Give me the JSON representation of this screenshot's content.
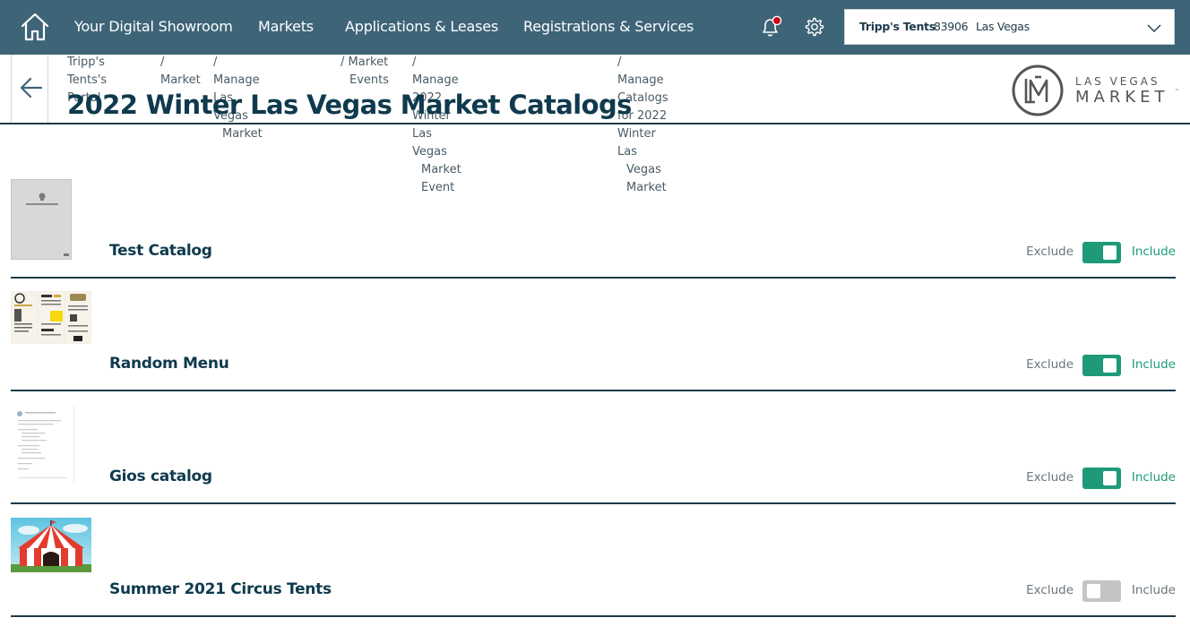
{
  "nav": {
    "items": [
      {
        "label": "Your Digital Showroom"
      },
      {
        "label": "Markets"
      },
      {
        "label": "Applications & Leases"
      },
      {
        "label": "Registrations & Services"
      }
    ],
    "account": {
      "name": "Tripp's Tents",
      "id": "83906",
      "location": "Las Vegas"
    },
    "icons": {
      "home": "home-icon",
      "bell": "bell-icon",
      "gear": "gear-icon",
      "chevron": "chevron-down-icon"
    },
    "notification_dot_color": "#d0021b"
  },
  "breadcrumb": [
    {
      "line1": "Tripp's Tents's",
      "line2": "Portal"
    },
    {
      "line1": "/ Market",
      "line2": ""
    },
    {
      "line1": "/ Manage Las Vegas",
      "line2": "Market"
    },
    {
      "line1": "/ Market",
      "line2": "Events"
    },
    {
      "line1": "/ Manage 2022 Winter Las Vegas",
      "line2": "Market Event"
    },
    {
      "line1": "/ Manage Catalogs for 2022 Winter Las",
      "line2": "Vegas Market"
    }
  ],
  "page": {
    "title": "2022 Winter Las Vegas Market Catalogs"
  },
  "logo": {
    "line1": "LAS VEGAS",
    "line2": "MARKET",
    "tm": "™"
  },
  "toggle_labels": {
    "exclude": "Exclude",
    "include": "Include"
  },
  "catalogs": [
    {
      "name": "Test Catalog",
      "included": true,
      "thumb": "gray-cover"
    },
    {
      "name": "Random Menu",
      "included": true,
      "thumb": "menu-foldout"
    },
    {
      "name": "Gios catalog",
      "included": true,
      "thumb": "document-page"
    },
    {
      "name": "Summer 2021 Circus Tents",
      "included": false,
      "thumb": "circus-tent"
    }
  ],
  "colors": {
    "nav_bg": "#3e6478",
    "toggle_on": "#1e9a78",
    "toggle_off": "#c4c4c4",
    "title": "#0f3a4d"
  }
}
